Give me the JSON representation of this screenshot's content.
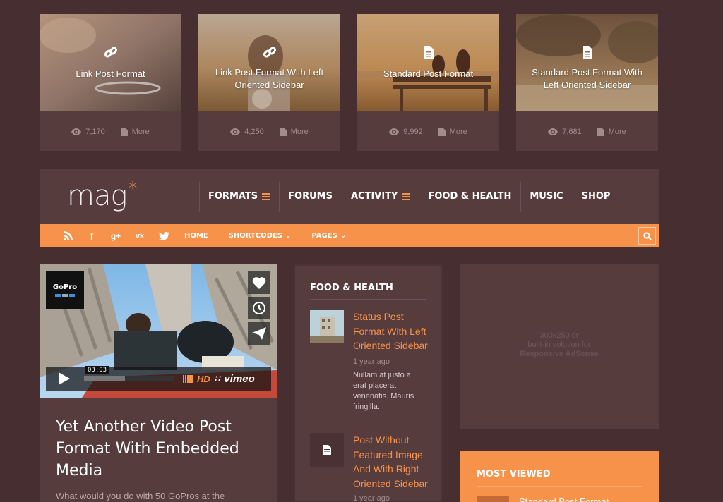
{
  "cards": [
    {
      "title": "Link Post Format",
      "format_icon": "link-icon",
      "views": "7,170",
      "more": "More"
    },
    {
      "title": "Link Post Format With Left Oriented Sidebar",
      "format_icon": "link-icon",
      "views": "4,250",
      "more": "More"
    },
    {
      "title": "Standard Post Format",
      "format_icon": "document-icon",
      "views": "9,992",
      "more": "More"
    },
    {
      "title": "Standard Post Format With Left Oriented Sidebar",
      "format_icon": "document-icon",
      "views": "7,681",
      "more": "More"
    }
  ],
  "header": {
    "logo": "mag",
    "logo_mark": "*",
    "nav": [
      {
        "label": "FORMATS",
        "has_menu": true
      },
      {
        "label": "FORUMS",
        "has_menu": false
      },
      {
        "label": "ACTIVITY",
        "has_menu": true
      },
      {
        "label": "FOOD & HEALTH",
        "has_menu": false
      },
      {
        "label": "MUSIC",
        "has_menu": false
      },
      {
        "label": "SHOP",
        "has_menu": false
      }
    ]
  },
  "subbar": {
    "social": [
      "rss-icon",
      "facebook-icon",
      "google-plus-icon",
      "vk-icon",
      "twitter-icon"
    ],
    "links": [
      {
        "label": "HOME",
        "dropdown": false
      },
      {
        "label": "SHORTCODES",
        "dropdown": true
      },
      {
        "label": "PAGES",
        "dropdown": true
      }
    ]
  },
  "video_post": {
    "brand": "GoPro",
    "timecode": "03:03",
    "hd": "HD",
    "provider": "vimeo",
    "progress": 0.45,
    "title": "Yet Another Video Post Format With Embedded Media",
    "excerpt": "What would you do with 50 GoPros at the"
  },
  "food_widget": {
    "heading": "FOOD & HEALTH",
    "items": [
      {
        "title": "Status Post Format With Left Oriented Sidebar",
        "date": "1 year ago",
        "excerpt": "Nullam at justo a erat placerat venenatis. Mauris fringilla."
      },
      {
        "title": "Post Without Featured Image And With Right Oriented Sidebar",
        "date": "1 year ago",
        "excerpt": ""
      }
    ]
  },
  "ad": {
    "line1": "300x250 or",
    "line2": "built-in solution for",
    "line3": "Responsive AdSense"
  },
  "most_viewed": {
    "heading": "MOST VIEWED",
    "first_title": "Standard Post Format"
  },
  "colors": {
    "accent": "#f7924a",
    "background": "#472f31",
    "panel": "#573c3e"
  }
}
